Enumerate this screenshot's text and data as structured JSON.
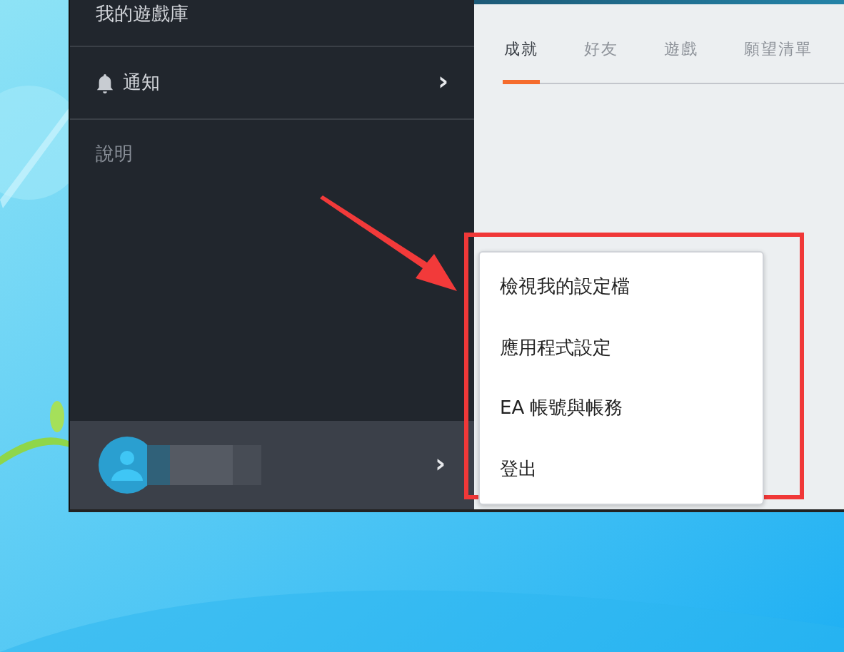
{
  "sidebar": {
    "items": [
      {
        "kind": "plain",
        "label": "我的遊戲庫"
      },
      {
        "kind": "notify",
        "label": "通知",
        "chevron": "›"
      },
      {
        "kind": "muted",
        "label": "說明"
      }
    ],
    "user": {
      "chevron": "›"
    }
  },
  "tabs": [
    {
      "label": "成就",
      "selected": true
    },
    {
      "label": "好友",
      "selected": false
    },
    {
      "label": "遊戲",
      "selected": false
    },
    {
      "label": "願望清單",
      "selected": false
    }
  ],
  "menu": {
    "items": [
      "檢視我的設定檔",
      "應用程式設定",
      "EA 帳號與帳務",
      "登出"
    ]
  }
}
